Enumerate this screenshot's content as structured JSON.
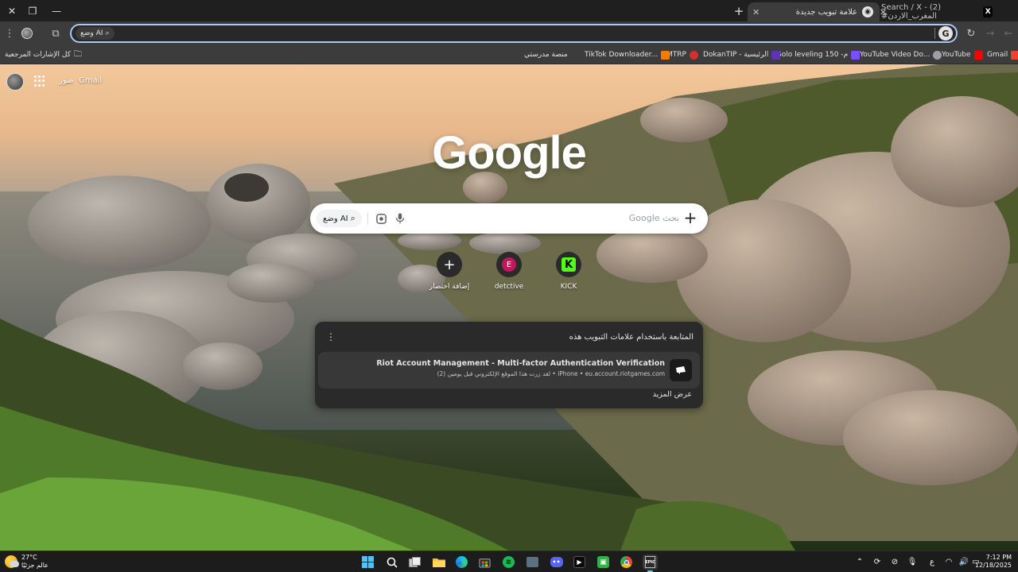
{
  "window": {
    "close_glyph": "✕",
    "restore_glyph": "❐",
    "minimize_glyph": "—"
  },
  "tabs": [
    {
      "title": "Search / X - (2) #المغرب_الاردن",
      "favicon": "x-logo-icon",
      "active": false
    },
    {
      "title": "علامة تبويب جديدة",
      "favicon": "chrome-icon",
      "active": true
    }
  ],
  "tabstrip": {
    "new_tab_glyph": "+"
  },
  "toolbar": {
    "ai_mode_label": "وضع AI",
    "omnibox_value": "",
    "google_badge": "G"
  },
  "bookmarks": {
    "all_bookmarks_label": "كل الإشارات المرجعية",
    "items": [
      {
        "label": "Gmail",
        "icon": "gmail-icon",
        "color": "#ea4335"
      },
      {
        "label": "YouTube",
        "icon": "youtube-icon",
        "color": "#ff0000"
      },
      {
        "label": "YouTube Video Do...",
        "icon": "globe-icon",
        "color": "#9aa0a6"
      },
      {
        "label": "Solo leveling 150 -م",
        "icon": "bookmark-favicon-icon",
        "color": "#7c4dff"
      },
      {
        "label": "DokanTIP - الرئيسية",
        "icon": "bookmark-favicon-icon",
        "color": "#5e35b1"
      },
      {
        "label": "MTRP",
        "icon": "bookmark-favicon-icon",
        "color": "#d32f2f"
      },
      {
        "label": "TikTok Downloader...",
        "icon": "bookmark-favicon-icon",
        "color": "#f57c00"
      },
      {
        "label": "منصة مدرستي",
        "icon": "bookmark-favicon-icon",
        "color": "#00897b"
      }
    ]
  },
  "ntp": {
    "gmail_label": "Gmail",
    "images_label": "صور",
    "logo_text": "Google",
    "search": {
      "placeholder": "بحث Google",
      "ai_mode_label": "وضع AI"
    },
    "shortcuts": [
      {
        "label": "KICK",
        "letter": "K",
        "color": "#53fc18"
      },
      {
        "label": "detctive",
        "letter": "E",
        "color": "#c2185b"
      },
      {
        "label": "إضافة اختصار",
        "letter": "+",
        "color": "#2a2a2a"
      }
    ],
    "resume_card": {
      "title": "المتابعة باستخدام علامات التبويب هذه",
      "item_title": "Riot Account Management - Multi-factor Authentication Verification",
      "item_subtitle": "iPhone • eu.account.riotgames.com • لقد زرت هذا الموقع الإلكتروني قبل يومين (2)",
      "more_label": "عرض المزيد"
    }
  },
  "taskbar": {
    "weather_temp": "27°C",
    "weather_desc": "عالم جزئيًا",
    "language": "ع",
    "time": "7:12 PM",
    "date": "12/18/2025",
    "apps": [
      {
        "name": "start-button",
        "icon": "windows-icon"
      },
      {
        "name": "search-button",
        "icon": "search-icon"
      },
      {
        "name": "task-view-button",
        "icon": "task-view-icon"
      },
      {
        "name": "file-explorer-button",
        "icon": "folder-icon"
      },
      {
        "name": "edge-button",
        "icon": "edge-icon"
      },
      {
        "name": "store-button",
        "icon": "store-icon"
      },
      {
        "name": "spotify-button",
        "icon": "spotify-icon"
      },
      {
        "name": "app-button",
        "icon": "app-icon"
      },
      {
        "name": "discord-button",
        "icon": "discord-icon"
      },
      {
        "name": "capcut-button",
        "icon": "capcut-icon"
      },
      {
        "name": "android-app-button",
        "icon": "android-icon"
      },
      {
        "name": "chrome-button",
        "icon": "chrome-icon"
      },
      {
        "name": "epic-games-button",
        "icon": "epic-games-icon"
      }
    ]
  }
}
